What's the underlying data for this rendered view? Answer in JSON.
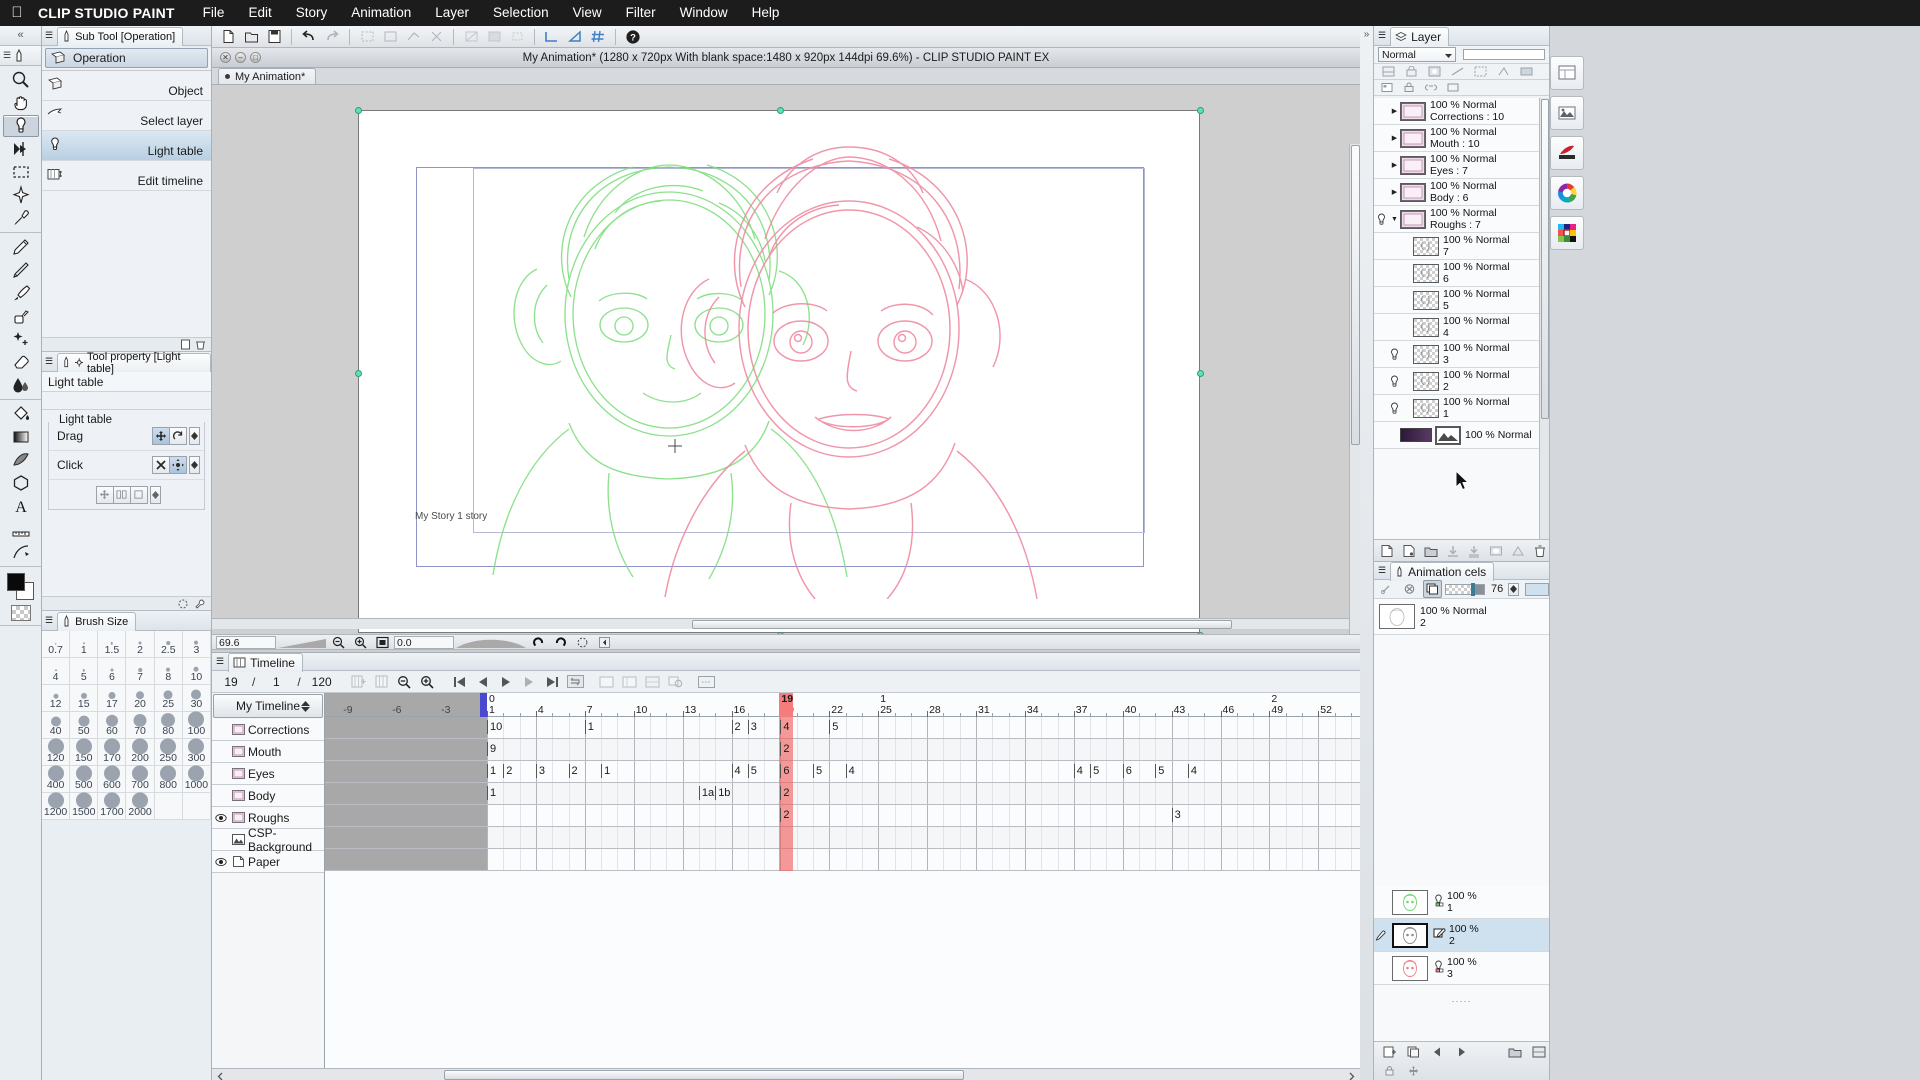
{
  "menubar": {
    "apple": "apple-logo",
    "app_name": "CLIP STUDIO PAINT",
    "items": [
      "File",
      "Edit",
      "Story",
      "Animation",
      "Layer",
      "Selection",
      "View",
      "Filter",
      "Window",
      "Help"
    ]
  },
  "document": {
    "title": "My Animation* (1280 x 720px With blank space:1480 x 920px 144dpi 69.6%)  - CLIP STUDIO PAINT EX",
    "tab_label": "My Animation*",
    "story_label": "My Story 1 story"
  },
  "status": {
    "zoom_value": "69.6",
    "rotate_value": "0.0"
  },
  "subtool": {
    "panel_tab": "Sub Tool [Operation]",
    "header": "Operation",
    "items": [
      {
        "label": "Object",
        "icon": "object-icon",
        "selected": false
      },
      {
        "label": "Select layer",
        "icon": "select-layer-icon",
        "selected": false
      },
      {
        "label": "Light table",
        "icon": "light-table-icon",
        "selected": true
      },
      {
        "label": "Edit timeline",
        "icon": "edit-timeline-icon",
        "selected": false
      }
    ]
  },
  "toolproperty": {
    "panel_tab": "Tool property [Light table]",
    "title": "Light table",
    "group_label": "Light table",
    "rows": [
      {
        "label": "Drag"
      },
      {
        "label": "Click"
      }
    ]
  },
  "brushsize": {
    "panel_tab": "Brush Size",
    "values": [
      "0.7",
      "1",
      "1.5",
      "2",
      "2.5",
      "3",
      "4",
      "5",
      "6",
      "7",
      "8",
      "10",
      "12",
      "15",
      "17",
      "20",
      "25",
      "30",
      "40",
      "50",
      "60",
      "70",
      "80",
      "100",
      "120",
      "150",
      "170",
      "200",
      "250",
      "300",
      "400",
      "500",
      "600",
      "700",
      "800",
      "1000",
      "1200",
      "1500",
      "1700",
      "2000",
      "",
      ""
    ]
  },
  "timeline": {
    "panel_tab": "Timeline",
    "current_frame": "19",
    "start_frame": "1",
    "end_frame": "120",
    "timeline_name": "My Timeline",
    "negative_ticks": [
      "-9",
      "-6",
      "-3"
    ],
    "ruler_major": [
      "1",
      "4",
      "7",
      "10",
      "13",
      "16",
      "19",
      "22",
      "25",
      "28",
      "31",
      "34",
      "37",
      "40",
      "43",
      "46",
      "49",
      "52"
    ],
    "ruler_seconds": [
      {
        "label": "0",
        "frame": 1
      },
      {
        "label": "1",
        "frame": 25
      },
      {
        "label": "2",
        "frame": 49
      }
    ],
    "playhead_frame": 19,
    "playhead_label": "19",
    "tracks": [
      {
        "name": "Corrections",
        "icon": "folder-layer-icon",
        "visible": false,
        "cells": [
          {
            "f": 1,
            "v": "10"
          },
          {
            "f": 7,
            "v": "1"
          },
          {
            "f": 16,
            "v": "2"
          },
          {
            "f": 17,
            "v": "3"
          },
          {
            "f": 19,
            "v": "4"
          },
          {
            "f": 22,
            "v": "5"
          }
        ]
      },
      {
        "name": "Mouth",
        "icon": "folder-layer-icon",
        "visible": false,
        "cells": [
          {
            "f": 1,
            "v": "9"
          },
          {
            "f": 19,
            "v": "2"
          }
        ]
      },
      {
        "name": "Eyes",
        "icon": "folder-layer-icon",
        "visible": false,
        "cells": [
          {
            "f": 1,
            "v": "1"
          },
          {
            "f": 2,
            "v": "2"
          },
          {
            "f": 4,
            "v": "3"
          },
          {
            "f": 6,
            "v": "2"
          },
          {
            "f": 8,
            "v": "1"
          },
          {
            "f": 16,
            "v": "4"
          },
          {
            "f": 17,
            "v": "5"
          },
          {
            "f": 19,
            "v": "6"
          },
          {
            "f": 21,
            "v": "5"
          },
          {
            "f": 23,
            "v": "4"
          },
          {
            "f": 37,
            "v": "4"
          },
          {
            "f": 38,
            "v": "5"
          },
          {
            "f": 40,
            "v": "6"
          },
          {
            "f": 42,
            "v": "5"
          },
          {
            "f": 44,
            "v": "4"
          }
        ]
      },
      {
        "name": "Body",
        "icon": "folder-layer-icon",
        "visible": false,
        "cells": [
          {
            "f": 1,
            "v": "1"
          },
          {
            "f": 14,
            "v": "1a"
          },
          {
            "f": 15,
            "v": "1b"
          },
          {
            "f": 19,
            "v": "2"
          }
        ]
      },
      {
        "name": "Roughs",
        "icon": "folder-layer-icon",
        "visible": true,
        "cells": [
          {
            "f": 1,
            "v": ""
          },
          {
            "f": 19,
            "v": "2"
          },
          {
            "f": 43,
            "v": "3"
          }
        ]
      },
      {
        "name": "CSP-Background",
        "icon": "image-layer-icon",
        "visible": false,
        "cells": []
      },
      {
        "name": "Paper",
        "icon": "paper-layer-icon",
        "visible": true,
        "cells": []
      }
    ]
  },
  "layers": {
    "panel_tab": "Layer",
    "blend_mode": "Normal",
    "opacity_label": "100",
    "items": [
      {
        "blend": "100 % Normal",
        "name": "Corrections : 10",
        "type": "folder",
        "expanded": false,
        "visible": false,
        "indent": 0
      },
      {
        "blend": "100 % Normal",
        "name": "Mouth : 10",
        "type": "folder",
        "expanded": false,
        "visible": false,
        "indent": 0
      },
      {
        "blend": "100 % Normal",
        "name": "Eyes : 7",
        "type": "folder",
        "expanded": false,
        "visible": false,
        "indent": 0
      },
      {
        "blend": "100 % Normal",
        "name": "Body : 6",
        "type": "folder",
        "expanded": false,
        "visible": false,
        "indent": 0
      },
      {
        "blend": "100 % Normal",
        "name": "Roughs : 7",
        "type": "folder",
        "expanded": true,
        "visible": true,
        "indent": 0
      },
      {
        "blend": "100 % Normal",
        "name": "7",
        "type": "raster",
        "visible": false,
        "indent": 1
      },
      {
        "blend": "100 % Normal",
        "name": "6",
        "type": "raster",
        "visible": false,
        "indent": 1
      },
      {
        "blend": "100 % Normal",
        "name": "5",
        "type": "raster",
        "visible": false,
        "indent": 1
      },
      {
        "blend": "100 % Normal",
        "name": "4",
        "type": "raster",
        "visible": false,
        "indent": 1
      },
      {
        "blend": "100 % Normal",
        "name": "3",
        "type": "raster",
        "visible": true,
        "indent": 1
      },
      {
        "blend": "100 % Normal",
        "name": "2",
        "type": "raster",
        "visible": true,
        "indent": 1
      },
      {
        "blend": "100 % Normal",
        "name": "1",
        "type": "raster",
        "visible": true,
        "indent": 1
      },
      {
        "blend": "100 % Normal",
        "name": "",
        "type": "background",
        "visible": false,
        "indent": 0
      }
    ]
  },
  "animation_cels": {
    "panel_tab": "Animation cels",
    "opacity_value": "76",
    "top_item": {
      "blend": "100 % Normal",
      "name": "2"
    },
    "cels": [
      {
        "opacity": "100 %",
        "name": "1",
        "color": "#6fd86f",
        "selected": false
      },
      {
        "opacity": "100 %",
        "name": "2",
        "color": "#8d8d8d",
        "selected": true
      },
      {
        "opacity": "100 %",
        "name": "3",
        "color": "#ef7f8e",
        "selected": false
      }
    ]
  },
  "right_toolbar": {
    "buttons": [
      "layout-icon",
      "material-icon",
      "quick-access-icon",
      "color-wheel-icon",
      "color-set-icon"
    ]
  },
  "colors": {
    "accent_blue": "#4a4ad0",
    "playhead_red": "#f05a5a",
    "selection_blue": "#cfe0ef",
    "green_cel": "#6fd86f",
    "pink_cel": "#ef7f8e"
  }
}
